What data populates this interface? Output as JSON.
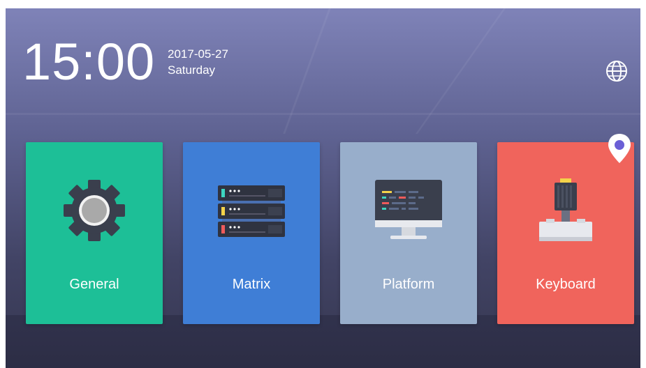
{
  "status": {
    "time": "15:00",
    "date": "2017-05-27",
    "weekday": "Saturday"
  },
  "header": {
    "language_icon": "globe-icon"
  },
  "cards": [
    {
      "label": "General",
      "icon": "gear-icon",
      "color": "#1dbf97"
    },
    {
      "label": "Matrix",
      "icon": "server-rack-icon",
      "color": "#3f7ed6"
    },
    {
      "label": "Platform",
      "icon": "monitor-icon",
      "color": "#98aecb"
    },
    {
      "label": "Keyboard",
      "icon": "joystick-keyboard-icon",
      "color": "#f0645c"
    }
  ],
  "marker": {
    "icon": "location-pin-icon",
    "color": "#ffffff"
  }
}
